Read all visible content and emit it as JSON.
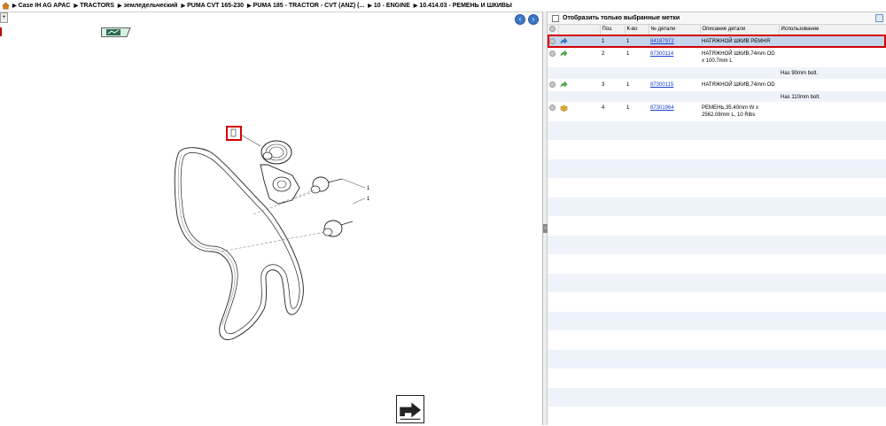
{
  "breadcrumb": [
    "Case IH AG APAC",
    "TRACTORS",
    "земледельческий",
    "PUMA CVT 165-230",
    "PUMA 185 - TRACTOR - CVT (ANZ) (...",
    "10 - ENGINE",
    "10.414.03 - РЕМЕНЬ И ШКИВЫ"
  ],
  "left": {
    "tab_label": "+",
    "prev_glyph": "‹",
    "next_glyph": "›"
  },
  "diagram": {
    "label_1a": "1",
    "label_1b": "1"
  },
  "right": {
    "filter_label": "Отобразить только выбранные метки",
    "columns": [
      "",
      "",
      "Поз.",
      "К-во",
      "№ детали",
      "Описание детали",
      "Использование"
    ],
    "rows": [
      {
        "pos": "1",
        "qty": "1",
        "part": "84187972",
        "desc": "НАТЯЖНОЙ ШКИВ РЕМНЯ",
        "use": "",
        "selected": true,
        "icon": "arrow-blue"
      },
      {
        "pos": "2",
        "qty": "1",
        "part": "87300114",
        "desc": "НАТЯЖНОЙ ШКИВ,74mm OD x 100.7mm L",
        "use": "",
        "selected": false,
        "icon": "arrow-green"
      },
      {
        "note": "Has 90mm bolt."
      },
      {
        "pos": "3",
        "qty": "1",
        "part": "87300115",
        "desc": "НАТЯЖНОЙ ШКИВ,74mm OD",
        "use": "",
        "selected": false,
        "icon": "arrow-green"
      },
      {
        "note": "Has 110mm bolt."
      },
      {
        "pos": "4",
        "qty": "1",
        "part": "87301964",
        "desc": "РЕМЕНЬ,35.40mm W x 2562.08mm L, 10 Ribs",
        "use": "",
        "selected": false,
        "icon": "box-yellow"
      }
    ]
  },
  "colors": {
    "accent_blue": "#3b78c7",
    "selection": "#c4d5ec",
    "highlight_red": "#d40000",
    "link": "#1a3fcc",
    "row_alt": "#eef3fa"
  }
}
